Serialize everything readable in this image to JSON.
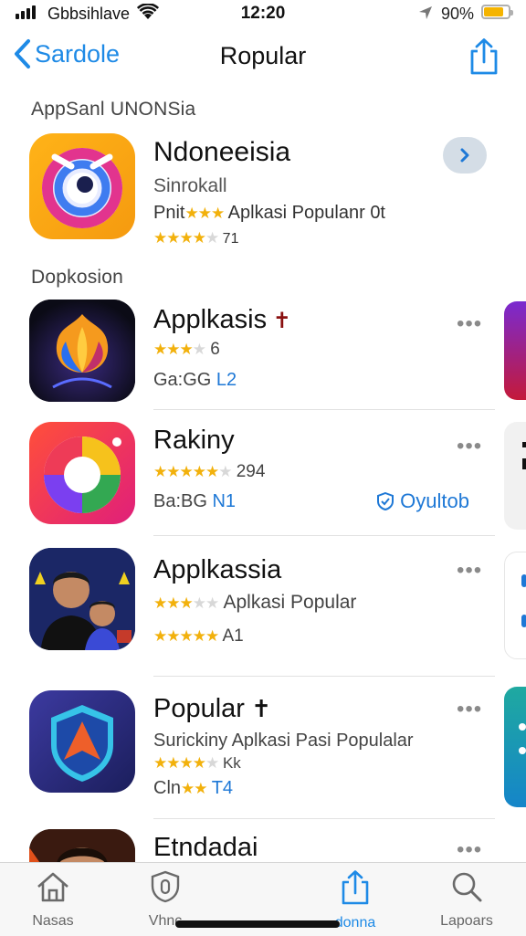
{
  "status_bar": {
    "carrier": "Gbbsihlave",
    "time": "12:20",
    "battery_text": "90%",
    "battery_level": 0.8
  },
  "nav": {
    "back_label": "Sardole",
    "title": "Ropular"
  },
  "featured_section": {
    "header": "AppSanl UNONSia",
    "app": {
      "name": "Ndoneeisia",
      "subtitle": "Sinrokall",
      "prefix": "Pnit",
      "description": "Aplkasi Populanr",
      "tail": "0t",
      "rating_text": "71",
      "icon": "o-ring-logo-icon"
    }
  },
  "list_section": {
    "header": "Dopkosion",
    "apps": [
      {
        "name": "Applkasis",
        "stars_text": "6",
        "line3": "Ga:GG",
        "line3_tag": "L2",
        "icon": "flame-flower-icon"
      },
      {
        "name": "Rakiny",
        "stars_text": "294",
        "line3": "Ba:BG",
        "line3_tag": "N1",
        "action": "Oyultob",
        "icon": "camera-ring-icon"
      },
      {
        "name": "Applkassia",
        "line2": "Aplkasi Popular",
        "stars_text": "A1",
        "icon": "portrait-icon"
      },
      {
        "name": "Popular",
        "line2": "Surickiny Aplkasi Pasi Populalar",
        "stars_text": "Kk",
        "line4_prefix": "Cln",
        "line4_tag": "T4",
        "icon": "shield-icon"
      },
      {
        "name": "Etndadai",
        "icon": "portrait-icon"
      }
    ]
  },
  "tab_bar": {
    "tabs": [
      {
        "label": "Nasas",
        "icon": "home-icon"
      },
      {
        "label": "Vhnc",
        "icon": "shield-outline-icon"
      },
      {
        "label": "donna",
        "icon": "share-icon",
        "active": true
      },
      {
        "label": "Lapoars",
        "icon": "search-icon"
      }
    ]
  },
  "colors": {
    "accent": "#1e8ae6",
    "star": "#f2b10c"
  }
}
